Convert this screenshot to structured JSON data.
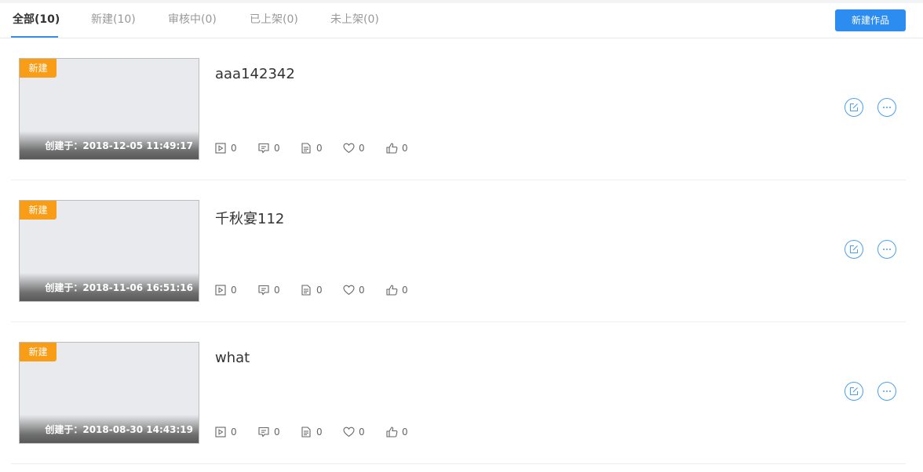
{
  "tabs": [
    {
      "label": "全部(10)",
      "active": true
    },
    {
      "label": "新建(10)",
      "active": false
    },
    {
      "label": "审核中(0)",
      "active": false
    },
    {
      "label": "已上架(0)",
      "active": false
    },
    {
      "label": "未上架(0)",
      "active": false
    }
  ],
  "new_button_label": "新建作品",
  "colors": {
    "accent": "#2d8cf0",
    "badge": "#fa9d16"
  },
  "works": [
    {
      "badge": "新建",
      "title": "aaa142342",
      "created": "创建于：2018-12-05 11:49:17",
      "stats": {
        "videos": "0",
        "comments": "0",
        "docs": "0",
        "favorites": "0",
        "likes": "0"
      }
    },
    {
      "badge": "新建",
      "title": "千秋宴112",
      "created": "创建于：2018-11-06 16:51:16",
      "stats": {
        "videos": "0",
        "comments": "0",
        "docs": "0",
        "favorites": "0",
        "likes": "0"
      }
    },
    {
      "badge": "新建",
      "title": "what",
      "created": "创建于：2018-08-30 14:43:19",
      "stats": {
        "videos": "0",
        "comments": "0",
        "docs": "0",
        "favorites": "0",
        "likes": "0"
      }
    }
  ],
  "icons": {
    "stats": [
      "video-icon",
      "comment-icon",
      "document-icon",
      "heart-icon",
      "thumbs-up-icon"
    ],
    "actions": [
      "edit-icon",
      "more-icon"
    ]
  }
}
